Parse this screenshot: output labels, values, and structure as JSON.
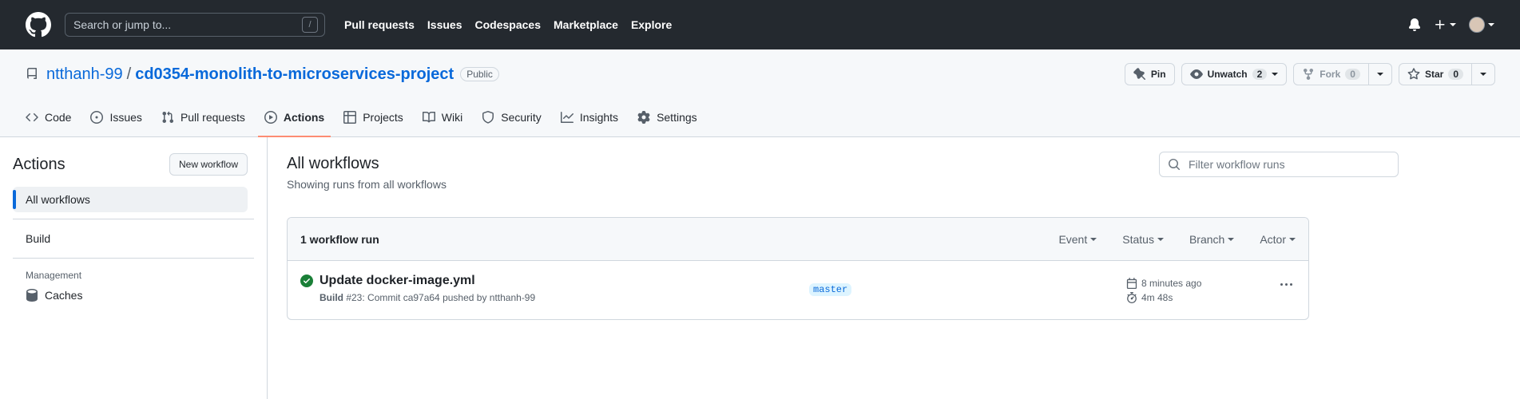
{
  "header": {
    "search_placeholder": "Search or jump to...",
    "search_shortcut": "/",
    "nav": [
      "Pull requests",
      "Issues",
      "Codespaces",
      "Marketplace",
      "Explore"
    ]
  },
  "repo": {
    "owner": "ntthanh-99",
    "separator": "/",
    "name": "cd0354-monolith-to-microservices-project",
    "visibility": "Public",
    "pin_label": "Pin",
    "unwatch_label": "Unwatch",
    "unwatch_count": "2",
    "fork_label": "Fork",
    "fork_count": "0",
    "star_label": "Star",
    "star_count": "0"
  },
  "tabs": [
    {
      "label": "Code",
      "icon": "code-icon"
    },
    {
      "label": "Issues",
      "icon": "issue-icon"
    },
    {
      "label": "Pull requests",
      "icon": "pull-request-icon"
    },
    {
      "label": "Actions",
      "icon": "play-icon",
      "selected": true
    },
    {
      "label": "Projects",
      "icon": "table-icon"
    },
    {
      "label": "Wiki",
      "icon": "book-icon"
    },
    {
      "label": "Security",
      "icon": "shield-icon"
    },
    {
      "label": "Insights",
      "icon": "graph-icon"
    },
    {
      "label": "Settings",
      "icon": "gear-icon"
    }
  ],
  "sidebar": {
    "title": "Actions",
    "new_workflow_label": "New workflow",
    "items": [
      "All workflows",
      "Build"
    ],
    "management_heading": "Management",
    "management_items": [
      "Caches"
    ]
  },
  "main": {
    "title": "All workflows",
    "subtitle": "Showing runs from all workflows",
    "filter_placeholder": "Filter workflow runs",
    "run_count": "1 workflow run",
    "filters": [
      "Event",
      "Status",
      "Branch",
      "Actor"
    ],
    "runs": [
      {
        "title": "Update docker-image.yml",
        "workflow": "Build",
        "meta_rest": " #23: Commit ca97a64 pushed by ntthanh-99",
        "branch": "master",
        "when": "8 minutes ago",
        "duration": "4m 48s",
        "status": "success"
      }
    ]
  },
  "colors": {
    "header_bg": "#24292f",
    "link": "#0969da",
    "success": "#1a7f37",
    "tab_underline": "#fd8c73"
  }
}
